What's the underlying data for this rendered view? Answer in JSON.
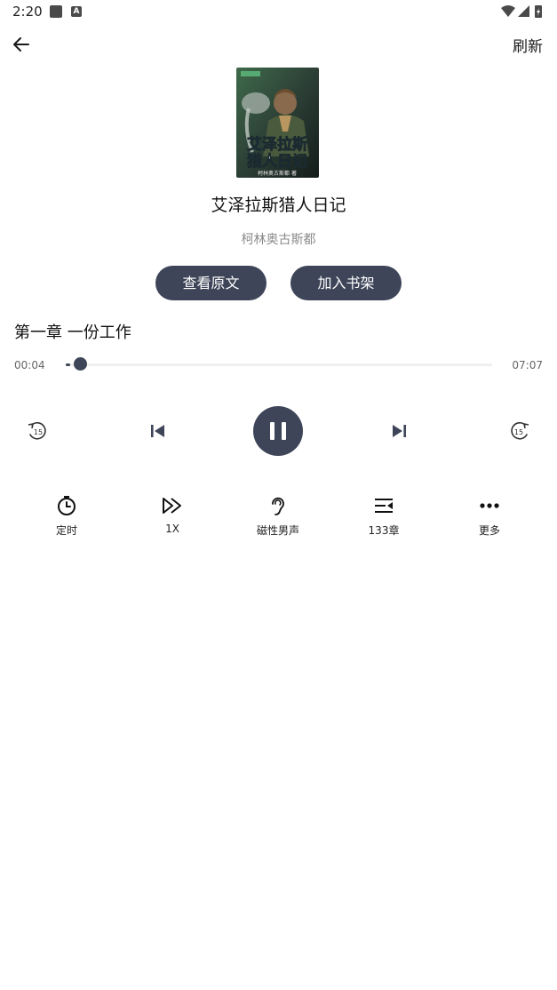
{
  "status_bar": {
    "time": "2:20",
    "notif_letter": "A"
  },
  "header": {
    "refresh_label": "刷新"
  },
  "book": {
    "title": "艾泽拉斯猎人日记",
    "author": "柯林奥古斯都",
    "cover_title_line1": "艾泽拉斯",
    "cover_title_line2": "猎人日记",
    "cover_author": "柯林奥古斯都 著"
  },
  "actions": {
    "view_original": "查看原文",
    "add_to_shelf": "加入书架"
  },
  "player": {
    "chapter_title": "第一章 一份工作",
    "current_time": "00:04",
    "total_time": "07:07",
    "progress": 0.0094,
    "rewind_seconds": "15",
    "forward_seconds": "15"
  },
  "toolbar": {
    "timer": "定时",
    "speed": "1X",
    "voice": "磁性男声",
    "chapters": "133章",
    "more": "更多"
  },
  "colors": {
    "accent": "#3e4558",
    "muted": "#8a8a8a"
  }
}
